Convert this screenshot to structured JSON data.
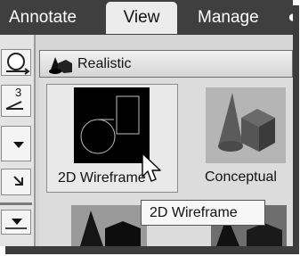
{
  "ribbon": {
    "tabs": [
      {
        "label": "Annotate"
      },
      {
        "label": "View"
      },
      {
        "label": "Manage"
      }
    ],
    "tool_label": "3"
  },
  "visual_styles": {
    "current": "Realistic",
    "items": [
      {
        "label": "2D Wireframe"
      },
      {
        "label": "Conceptual"
      }
    ]
  },
  "tooltip": "2D Wireframe"
}
